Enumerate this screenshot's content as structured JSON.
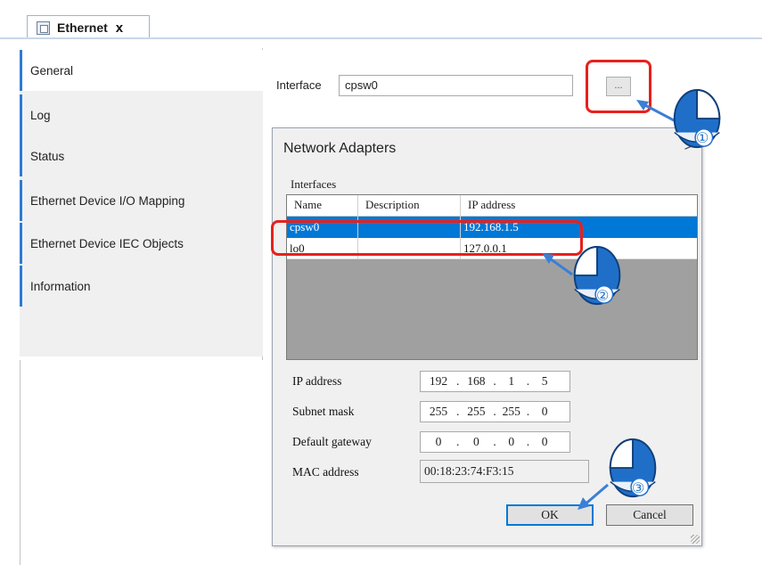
{
  "tab": {
    "title": "Ethernet",
    "close": "x"
  },
  "sidebar": {
    "items": [
      {
        "label": "General"
      },
      {
        "label": "Log"
      },
      {
        "label": "Status"
      },
      {
        "label": "Ethernet Device I/O Mapping"
      },
      {
        "label": "Ethernet Device IEC Objects"
      },
      {
        "label": "Information"
      }
    ]
  },
  "interface": {
    "label": "Interface",
    "value": "cpsw0",
    "browse": "..."
  },
  "dialog": {
    "title": "Network Adapters",
    "close": ">",
    "group": "Interfaces",
    "columns": [
      "Name",
      "Description",
      "IP address"
    ],
    "rows": [
      {
        "name": "cpsw0",
        "description": "",
        "ip": "192.168.1.5",
        "selected": true
      },
      {
        "name": "lo0",
        "description": "",
        "ip": "127.0.0.1",
        "selected": false
      }
    ],
    "ip_label": "IP address",
    "ip": [
      "192",
      "168",
      "1",
      "5"
    ],
    "mask_label": "Subnet mask",
    "mask": [
      "255",
      "255",
      "255",
      "0"
    ],
    "gw_label": "Default gateway",
    "gw": [
      "0",
      "0",
      "0",
      "0"
    ],
    "mac_label": "MAC address",
    "mac": "00:18:23:74:F3:15",
    "ok": "OK",
    "cancel": "Cancel"
  },
  "callouts": [
    "①",
    "②",
    "③"
  ],
  "colors": {
    "highlight": "#e8201b",
    "selection": "#0078d7",
    "mouse": "#1f6fc9",
    "arrow": "#3b7fd6"
  }
}
